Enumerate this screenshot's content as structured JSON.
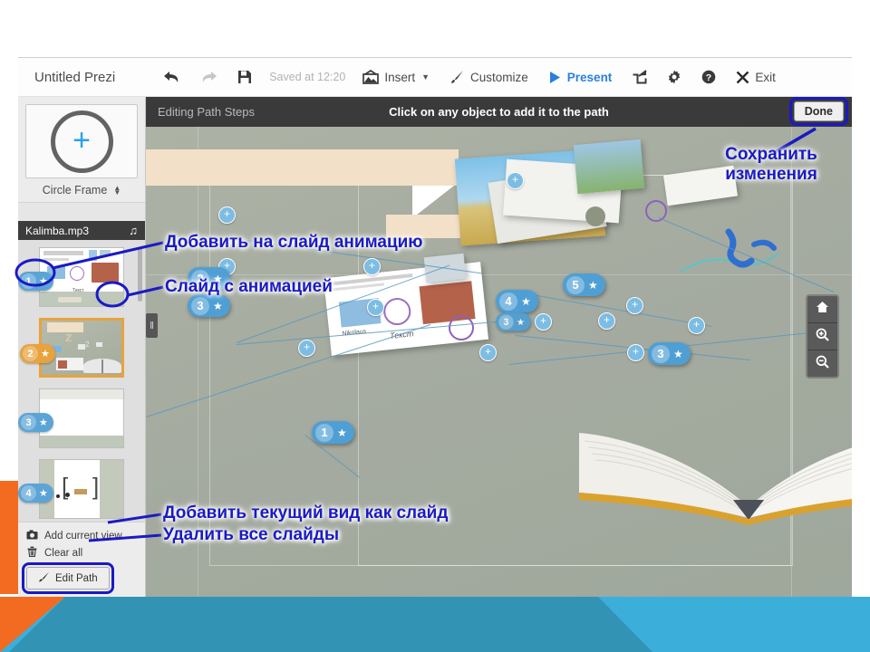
{
  "toolbar": {
    "title": "Untitled Prezi",
    "undo_icon": "undo-arrow-icon",
    "redo_icon": "redo-arrow-icon",
    "save_icon": "floppy-disk-icon",
    "saved_status": "Saved at 12:20",
    "insert_label": "Insert",
    "customize_label": "Customize",
    "present_label": "Present",
    "share_icon": "share-icon",
    "settings_icon": "gear-icon",
    "help_icon": "help-icon",
    "exit_label": "Exit"
  },
  "sidebar": {
    "frame_plus": "+",
    "frame_type": "Circle Frame",
    "audio_file": "Kalimba.mp3",
    "audio_note_glyph": "♫",
    "thumbnails": [
      {
        "number": "1",
        "star": "★",
        "selected": false
      },
      {
        "number": "2",
        "star": "★",
        "selected": true
      },
      {
        "number": "3",
        "star": "★",
        "selected": false
      },
      {
        "number": "4",
        "star": "★",
        "selected": false
      }
    ],
    "actions": {
      "add_current_view": "Add current view",
      "clear_all": "Clear all",
      "edit_path": "Edit Path"
    }
  },
  "path_bar": {
    "left_label": "Editing Path Steps",
    "center_hint": "Click on any object to add it to the path",
    "done_label": "Done"
  },
  "canvas": {
    "steps": [
      {
        "number": "1",
        "star": "★"
      },
      {
        "number": "2",
        "star": "★"
      },
      {
        "number": "3",
        "star": "★"
      },
      {
        "number": "3",
        "star": "★"
      },
      {
        "number": "4",
        "star": "★"
      },
      {
        "number": "5",
        "star": "★"
      }
    ],
    "plus_glyph": "+",
    "zoom_controls": {
      "home": "home-icon",
      "zoom_in": "zoom-in-icon",
      "zoom_out": "zoom-out-icon"
    },
    "collapse_handle": "‖"
  },
  "annotations": {
    "save_changes_line1": "Сохранить",
    "save_changes_line2": "изменения",
    "add_animation": "Добавить на слайд анимацию",
    "slide_with_animation": "Слайд с анимацией",
    "add_current_view_as_slide": "Добавить текущий вид как слайд",
    "delete_all_slides": "Удалить все слайды"
  },
  "colors": {
    "annotation": "#1A1AC4",
    "accent_orange": "#F26B21",
    "accent_cyan": "#3BAFDA",
    "present_blue": "#2a7fe0",
    "selected_step": "#E8A33D",
    "step_blue": "#4F9FD4"
  }
}
